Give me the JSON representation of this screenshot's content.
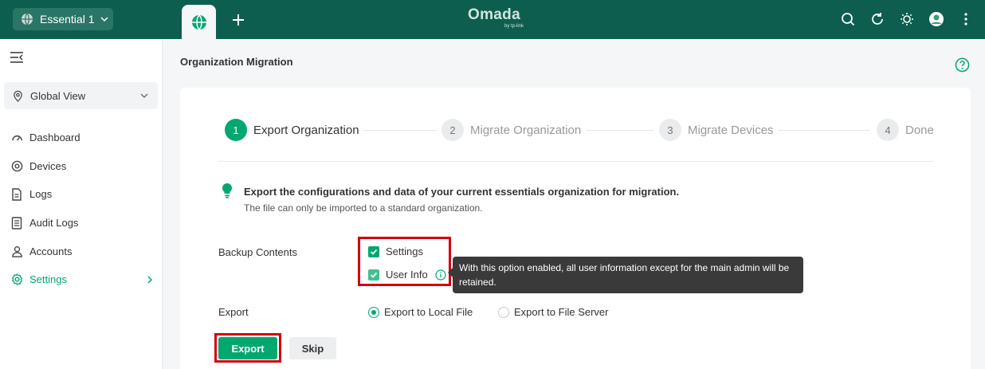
{
  "topbar": {
    "org_name": "Essential 1",
    "logo_main": "Omada",
    "logo_sub": "by tp-link",
    "icons": [
      "search-icon",
      "refresh-icon",
      "theme-icon",
      "avatar",
      "more-icon"
    ],
    "colors": {
      "bar": "#0e5e4f",
      "accent": "#00a870"
    }
  },
  "sidebar": {
    "site": "Global View",
    "items": [
      {
        "label": "Dashboard",
        "icon": "dashboard-icon"
      },
      {
        "label": "Devices",
        "icon": "devices-icon"
      },
      {
        "label": "Logs",
        "icon": "logs-icon"
      },
      {
        "label": "Audit Logs",
        "icon": "audit-logs-icon"
      },
      {
        "label": "Accounts",
        "icon": "accounts-icon"
      },
      {
        "label": "Settings",
        "icon": "settings-icon",
        "active": true
      }
    ]
  },
  "main": {
    "title": "Organization Migration",
    "steps": [
      {
        "num": "1",
        "label": "Export Organization",
        "active": true
      },
      {
        "num": "2",
        "label": "Migrate Organization"
      },
      {
        "num": "3",
        "label": "Migrate Devices"
      },
      {
        "num": "4",
        "label": "Done"
      }
    ],
    "tip_title": "Export the configurations and data of your current essentials organization for migration.",
    "tip_sub": "The file can only be imported to a standard organization.",
    "backup_label": "Backup Contents",
    "backup_options": [
      {
        "label": "Settings",
        "checked": true
      },
      {
        "label": "User Info",
        "checked": true
      }
    ],
    "tooltip": "With this option enabled, all user information except for the main admin will be retained.",
    "export_label": "Export",
    "export_options": [
      {
        "label": "Export to Local File",
        "selected": true
      },
      {
        "label": "Export to File Server",
        "selected": false
      }
    ],
    "export_button": "Export",
    "skip_button": "Skip"
  }
}
